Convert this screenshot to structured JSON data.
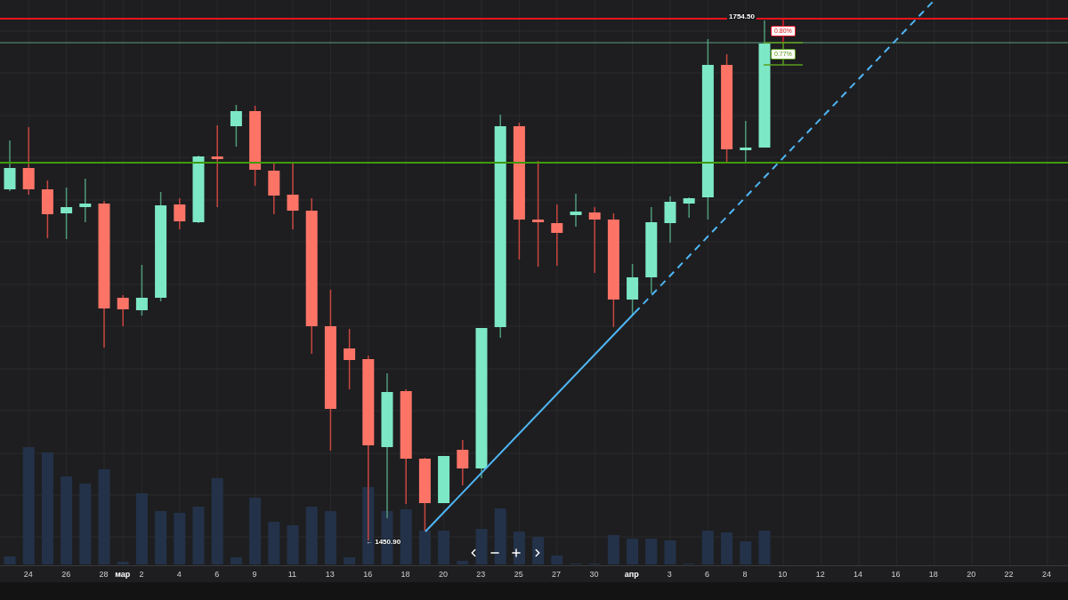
{
  "chart": {
    "price_labels": [
      {
        "kind": "high",
        "text": "1754.50"
      },
      {
        "kind": "low",
        "text": "← 1450.90"
      }
    ],
    "measure_badges": [
      {
        "text": "0.80%",
        "color": "#e0162b"
      },
      {
        "text": "0.77%",
        "color": "#5a9e1e"
      }
    ]
  },
  "x_axis": {
    "labels": [
      {
        "text": "24",
        "kind": "day"
      },
      {
        "text": "26",
        "kind": "day"
      },
      {
        "text": "28",
        "kind": "day"
      },
      {
        "text": "мар",
        "kind": "month"
      },
      {
        "text": "2",
        "kind": "day"
      },
      {
        "text": "4",
        "kind": "day"
      },
      {
        "text": "6",
        "kind": "day"
      },
      {
        "text": "9",
        "kind": "day"
      },
      {
        "text": "11",
        "kind": "day"
      },
      {
        "text": "13",
        "kind": "day"
      },
      {
        "text": "16",
        "kind": "day"
      },
      {
        "text": "18",
        "kind": "day"
      },
      {
        "text": "20",
        "kind": "day"
      },
      {
        "text": "23",
        "kind": "day"
      },
      {
        "text": "25",
        "kind": "day"
      },
      {
        "text": "27",
        "kind": "day"
      },
      {
        "text": "30",
        "kind": "day"
      },
      {
        "text": "апр",
        "kind": "month"
      },
      {
        "text": "3",
        "kind": "day"
      },
      {
        "text": "6",
        "kind": "day"
      },
      {
        "text": "8",
        "kind": "day"
      },
      {
        "text": "10",
        "kind": "day"
      },
      {
        "text": "12",
        "kind": "day"
      },
      {
        "text": "14",
        "kind": "day"
      },
      {
        "text": "16",
        "kind": "day"
      },
      {
        "text": "18",
        "kind": "day"
      },
      {
        "text": "20",
        "kind": "day"
      },
      {
        "text": "22",
        "kind": "day"
      },
      {
        "text": "24",
        "kind": "day"
      }
    ]
  }
}
